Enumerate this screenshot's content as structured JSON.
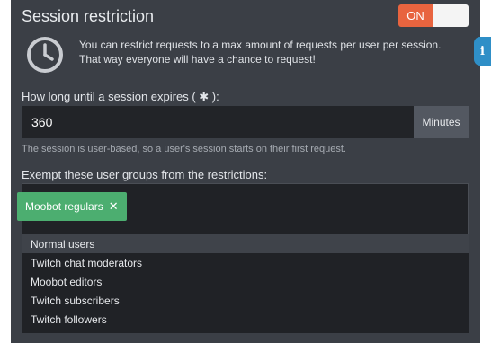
{
  "header": {
    "title": "Session restriction"
  },
  "toggle": {
    "state_label": "ON"
  },
  "notice": {
    "line1": "You can restrict requests to a max amount of requests per user per session.",
    "line2": "That way everyone will have a chance to request!",
    "icon": "clock-icon"
  },
  "info_tab": {
    "label": "i",
    "icon": "info-icon"
  },
  "session": {
    "label": "How long until a session expires ( ✱ ):",
    "value": "360",
    "unit": "Minutes",
    "help": "The session is user-based, so a user's session starts on their first request."
  },
  "exempt": {
    "label": "Exempt these user groups from the restrictions:",
    "selected_tag": "Moobot regulars",
    "remove_glyph": "✕",
    "options": [
      "Normal users",
      "Twitch chat moderators",
      "Moobot editors",
      "Twitch subscribers",
      "Twitch followers"
    ]
  },
  "colors": {
    "panel": "#3b3f46",
    "toggle_on": "#e8643f",
    "tag": "#4cae70",
    "info": "#2f8fc7"
  }
}
